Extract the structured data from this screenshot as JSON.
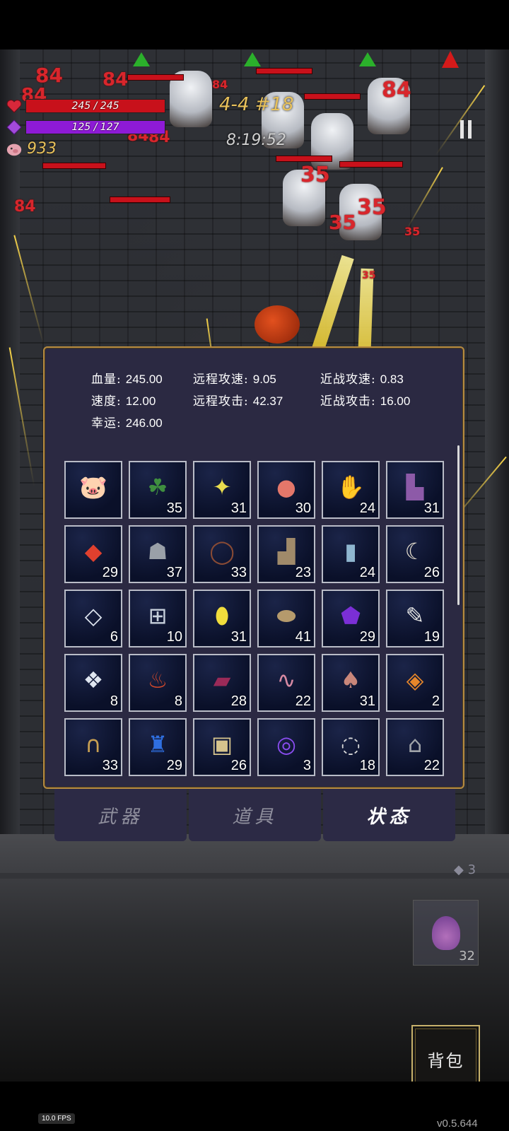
{
  "hud": {
    "hp_text": "245 / 245",
    "hp_fraction": 1.0,
    "mp_text": "125 / 127",
    "mp_fraction": 0.984,
    "gold": "933",
    "stage": "4-4 #18",
    "timer": "8:19:52",
    "hp_icon": "heart-icon",
    "mp_icon": "gem-icon",
    "gold_icon": "piggy-icon",
    "colors": {
      "hp": "#c8111b",
      "mp": "#8e1ad6",
      "gold": "#e8c15a"
    }
  },
  "damage_numbers": [
    "84",
    "84",
    "84",
    "84",
    "84",
    "84",
    "84",
    "84",
    "35",
    "35",
    "35",
    "35",
    "35"
  ],
  "stats": [
    {
      "label": "血量:",
      "value": "245.00"
    },
    {
      "label": "远程攻速:",
      "value": "9.05"
    },
    {
      "label": "近战攻速:",
      "value": "0.83"
    },
    {
      "label": "速度:",
      "value": "12.00"
    },
    {
      "label": "远程攻击:",
      "value": "42.37"
    },
    {
      "label": "近战攻击:",
      "value": "16.00"
    },
    {
      "label": "幸运:",
      "value": "246.00"
    }
  ],
  "items": [
    {
      "icon": "piggy-bank-icon",
      "count": ""
    },
    {
      "icon": "clover-icon",
      "count": "35"
    },
    {
      "icon": "star-icon",
      "count": "31"
    },
    {
      "icon": "apple-icon",
      "count": "30"
    },
    {
      "icon": "gloves-icon",
      "count": "24"
    },
    {
      "icon": "boots-icon",
      "count": "31"
    },
    {
      "icon": "red-crystal-icon",
      "count": "29"
    },
    {
      "icon": "cloak-icon",
      "count": "37"
    },
    {
      "icon": "thorn-crown-icon",
      "count": "33"
    },
    {
      "icon": "shoes-icon",
      "count": "23"
    },
    {
      "icon": "bottle-icon",
      "count": "24"
    },
    {
      "icon": "horn-icon",
      "count": "26"
    },
    {
      "icon": "diamond-plate-icon",
      "count": "6"
    },
    {
      "icon": "medkit-icon",
      "count": "10"
    },
    {
      "icon": "yellow-gem-icon",
      "count": "31"
    },
    {
      "icon": "egg-icon",
      "count": "41"
    },
    {
      "icon": "purple-snail-icon",
      "count": "29"
    },
    {
      "icon": "feather-icon",
      "count": "19"
    },
    {
      "icon": "diamond-cluster-icon",
      "count": "8"
    },
    {
      "icon": "fire-pouch-icon",
      "count": "8"
    },
    {
      "icon": "spellbook-icon",
      "count": "28"
    },
    {
      "icon": "worm-icon",
      "count": "22"
    },
    {
      "icon": "mushroom-icon",
      "count": "31"
    },
    {
      "icon": "fire-tome-icon",
      "count": "2"
    },
    {
      "icon": "horseshoe-icon",
      "count": "33"
    },
    {
      "icon": "blue-potion-icon",
      "count": "29"
    },
    {
      "icon": "ore-icon",
      "count": "26"
    },
    {
      "icon": "spiral-rune-icon",
      "count": "3"
    },
    {
      "icon": "rings-icon",
      "count": "18"
    },
    {
      "icon": "tombstone-icon",
      "count": "22"
    }
  ],
  "tabs": [
    {
      "label": "武器",
      "active": false
    },
    {
      "label": "道具",
      "active": false
    },
    {
      "label": "状态",
      "active": true
    }
  ],
  "side_count": "3",
  "potion_count": "32",
  "bag_label": "背包",
  "fps": "10.0 FPS",
  "version": "v0.5.644"
}
